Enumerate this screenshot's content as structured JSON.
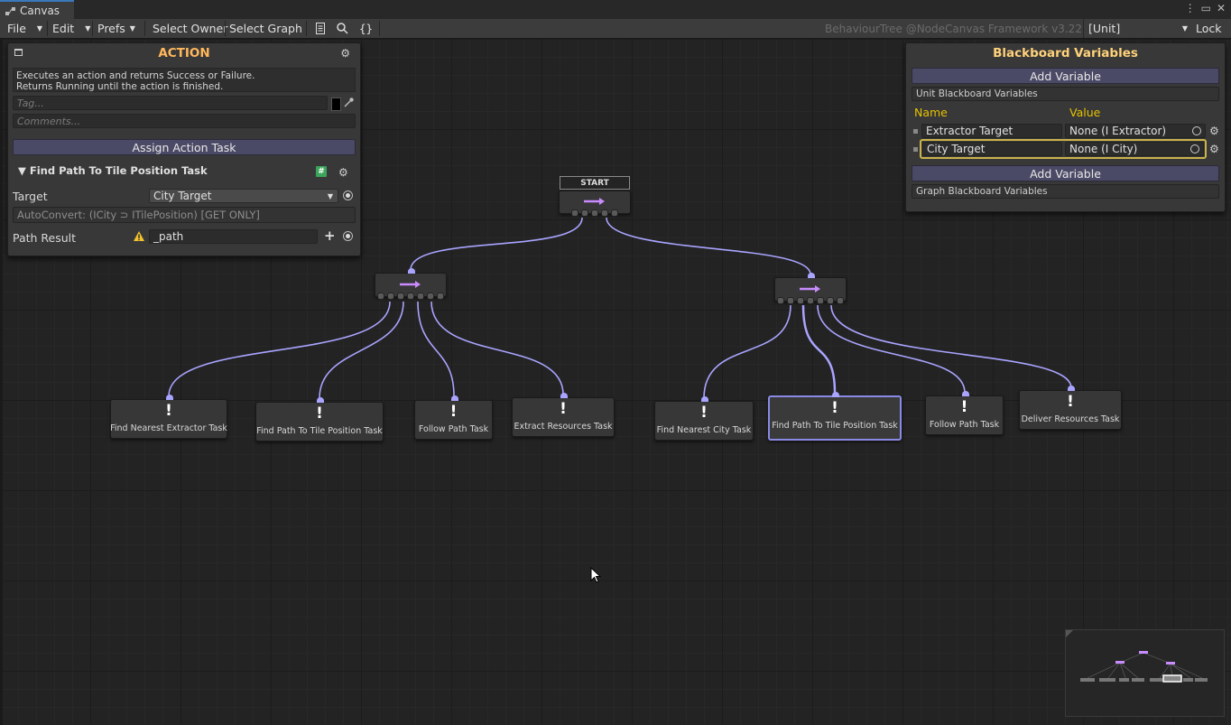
{
  "window": {
    "tab_title": "Canvas",
    "controls": [
      "⋮",
      "▭",
      "✕"
    ]
  },
  "toolbar": {
    "file": "File",
    "edit": "Edit",
    "prefs": "Prefs",
    "select_owner": "Select Owner",
    "select_graph": "Select Graph",
    "icon_doc": "document-icon",
    "icon_search": "search-icon",
    "icon_braces": "{}",
    "framework": "BehaviourTree @NodeCanvas Framework v3.22",
    "unit_selector": "[Unit]",
    "lock": "Lock"
  },
  "action_panel": {
    "title": "ACTION",
    "description_line1": "Executes an action and returns Success or Failure.",
    "description_line2": "Returns Running until the action is finished.",
    "tag_placeholder": "Tag...",
    "comments_placeholder": "Comments...",
    "assign_button": "Assign Action Task",
    "task_title": "Find Path To Tile Position Task",
    "target_label": "Target",
    "target_value": "City Target",
    "autoconvert": "AutoConvert: (ICity ⊃ ITilePosition) [GET ONLY]",
    "path_result_label": "Path Result",
    "path_result_value": "_path"
  },
  "blackboard": {
    "title": "Blackboard Variables",
    "add_variable_1": "Add Variable",
    "unit_section": "Unit Blackboard Variables",
    "col_name": "Name",
    "col_value": "Value",
    "variables": [
      {
        "name": "Extractor Target",
        "value": "None (I Extractor)"
      },
      {
        "name": "City Target",
        "value": "None (I City)"
      }
    ],
    "add_variable_2": "Add Variable",
    "graph_section": "Graph Blackboard Variables"
  },
  "graph": {
    "start_label": "START",
    "left_children": [
      "Find Nearest Extractor Task",
      "Find Path To Tile Position Task",
      "Follow Path Task",
      "Extract Resources Task"
    ],
    "right_children": [
      "Find Nearest City Task",
      "Find Path To Tile Position Task",
      "Follow Path Task",
      "Deliver Resources Task"
    ],
    "node_icon": "!",
    "sequencer_icon": "arrow-right-icon",
    "colors": {
      "wire": "#a9a4ff",
      "accent_title": "#ffb85c",
      "blackboard_title": "#ffd27a",
      "selected": "#8a8ae6",
      "header_yellow": "#e6c200"
    }
  }
}
